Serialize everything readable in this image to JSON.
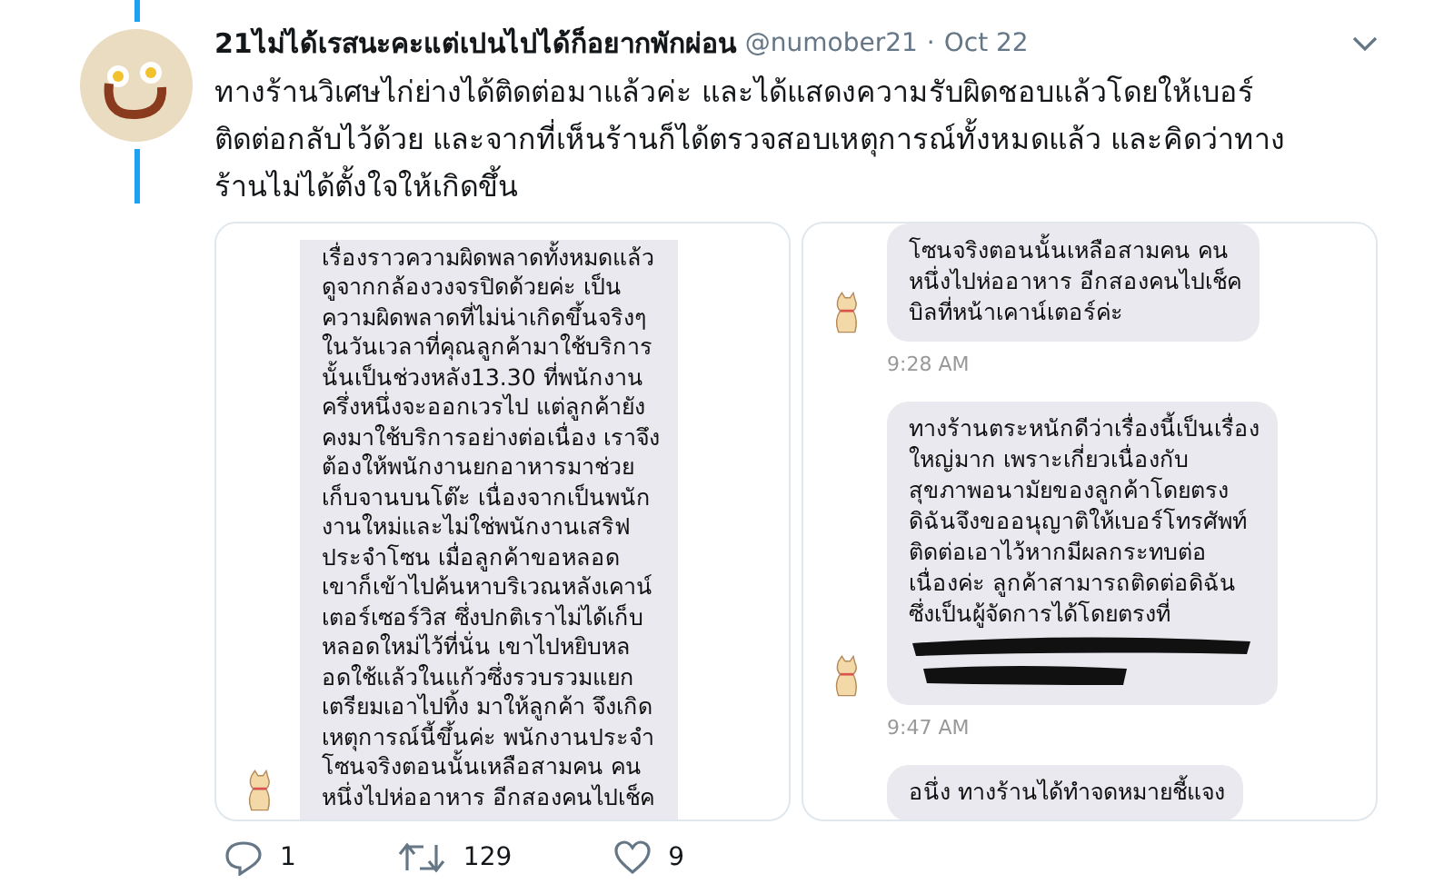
{
  "tweet": {
    "display_name": "21ไม่ได้เรสนะคะแต่เปนไปได้ก็อยากพักผ่อน",
    "handle": "@numober21",
    "separator": "·",
    "date": "Oct 22",
    "text": "ทางร้านวิเศษไก่ย่างได้ติดต่อมาแล้วค่ะ และได้แสดงความรับผิดชอบแล้วโดยให้เบอร์ติดต่อกลับไว้ด้วย และจากที่เห็นร้านก็ได้ตรวจสอบเหตุการณ์ทั้งหมดแล้ว และคิดว่าทางร้านไม่ได้ตั้งใจให้เกิดขึ้น",
    "media": [
      {
        "kind": "chat",
        "messages": [
          {
            "kind": "bubble",
            "sender_icon": true,
            "redacted": false,
            "lines": [
              "เรื่องราวความผิดพลาดทั้งหมดแล้ว",
              "ดูจากกล้องวงจรปิดด้วยค่ะ เป็น",
              "ความผิดพลาดที่ไม่น่าเกิดขึ้นจริงๆ",
              "ในวันเวลาที่คุณลูกค้ามาใช้บริการ",
              "นั้นเป็นช่วงหลัง13.30 ที่พนักงาน",
              "ครึ่งหนึ่งจะออกเวรไป แต่ลูกค้ายัง",
              "คงมาใช้บริการอย่างต่อเนื่อง เราจึง",
              "ต้องให้พนักงานยกอาหารมาช่วย",
              "เก็บจานบนโต๊ะ เนื่องจากเป็นพนัก",
              "งานใหม่และไม่ใช่พนักงานเสริฟ",
              "ประจำโซน เมื่อลูกค้าขอหลอด",
              "เขาก็เข้าไปค้นหาบริเวณหลังเคาน์",
              "เตอร์เซอร์วิส ซึ่งปกติเราไม่ได้เก็บ",
              "หลอดใหม่ไว้ที่นั่น เขาไปหยิบหล",
              "อดใช้แล้วในแก้วซึ่งรวบรวมแยก",
              "เตรียมเอาไปทิ้ง มาให้ลูกค้า จึงเกิด",
              "เหตุการณ์นี้ขึ้นค่ะ พนักงานประจำ",
              "โซนจริงตอนนั้นเหลือสามคน คน",
              "หนึ่งไปห่ออาหาร อีกสองคนไปเช็ค"
            ]
          }
        ]
      },
      {
        "kind": "chat",
        "messages": [
          {
            "kind": "bubble",
            "sender_icon": true,
            "redacted": false,
            "lines": [
              "โซนจริงตอนนั้นเหลือสามคน คน",
              "หนึ่งไปห่ออาหาร อีกสองคนไปเช็ค",
              "บิลที่หน้าเคาน์เตอร์ค่ะ"
            ]
          },
          {
            "kind": "time",
            "text": "9:28 AM"
          },
          {
            "kind": "bubble",
            "sender_icon": true,
            "redacted": true,
            "lines": [
              "ทางร้านตระหนักดีว่าเรื่องนี้เป็นเรื่อง",
              "ใหญ่มาก เพราะเกี่ยวเนื่องกับ",
              "สุขภาพอนามัยของลูกค้าโดยตรง",
              "ดิฉันจึงขออนุญาติให้เบอร์โทรศัพท์",
              "ติดต่อเอาไว้หากมีผลกระทบต่อ",
              "เนื่องค่ะ ลูกค้าสามารถติดต่อดิฉัน",
              "ซึ่งเป็นผู้จัดการได้โดยตรงที่"
            ]
          },
          {
            "kind": "time",
            "text": "9:47 AM"
          },
          {
            "kind": "bubble",
            "sender_icon": false,
            "redacted": false,
            "lines": [
              "อนึ่ง ทางร้านได้ทำจดหมายชี้แจง"
            ]
          }
        ]
      }
    ],
    "actions": [
      {
        "kind": "reply",
        "count": "1"
      },
      {
        "kind": "retweet",
        "count": "129"
      },
      {
        "kind": "like",
        "count": "9"
      }
    ]
  }
}
